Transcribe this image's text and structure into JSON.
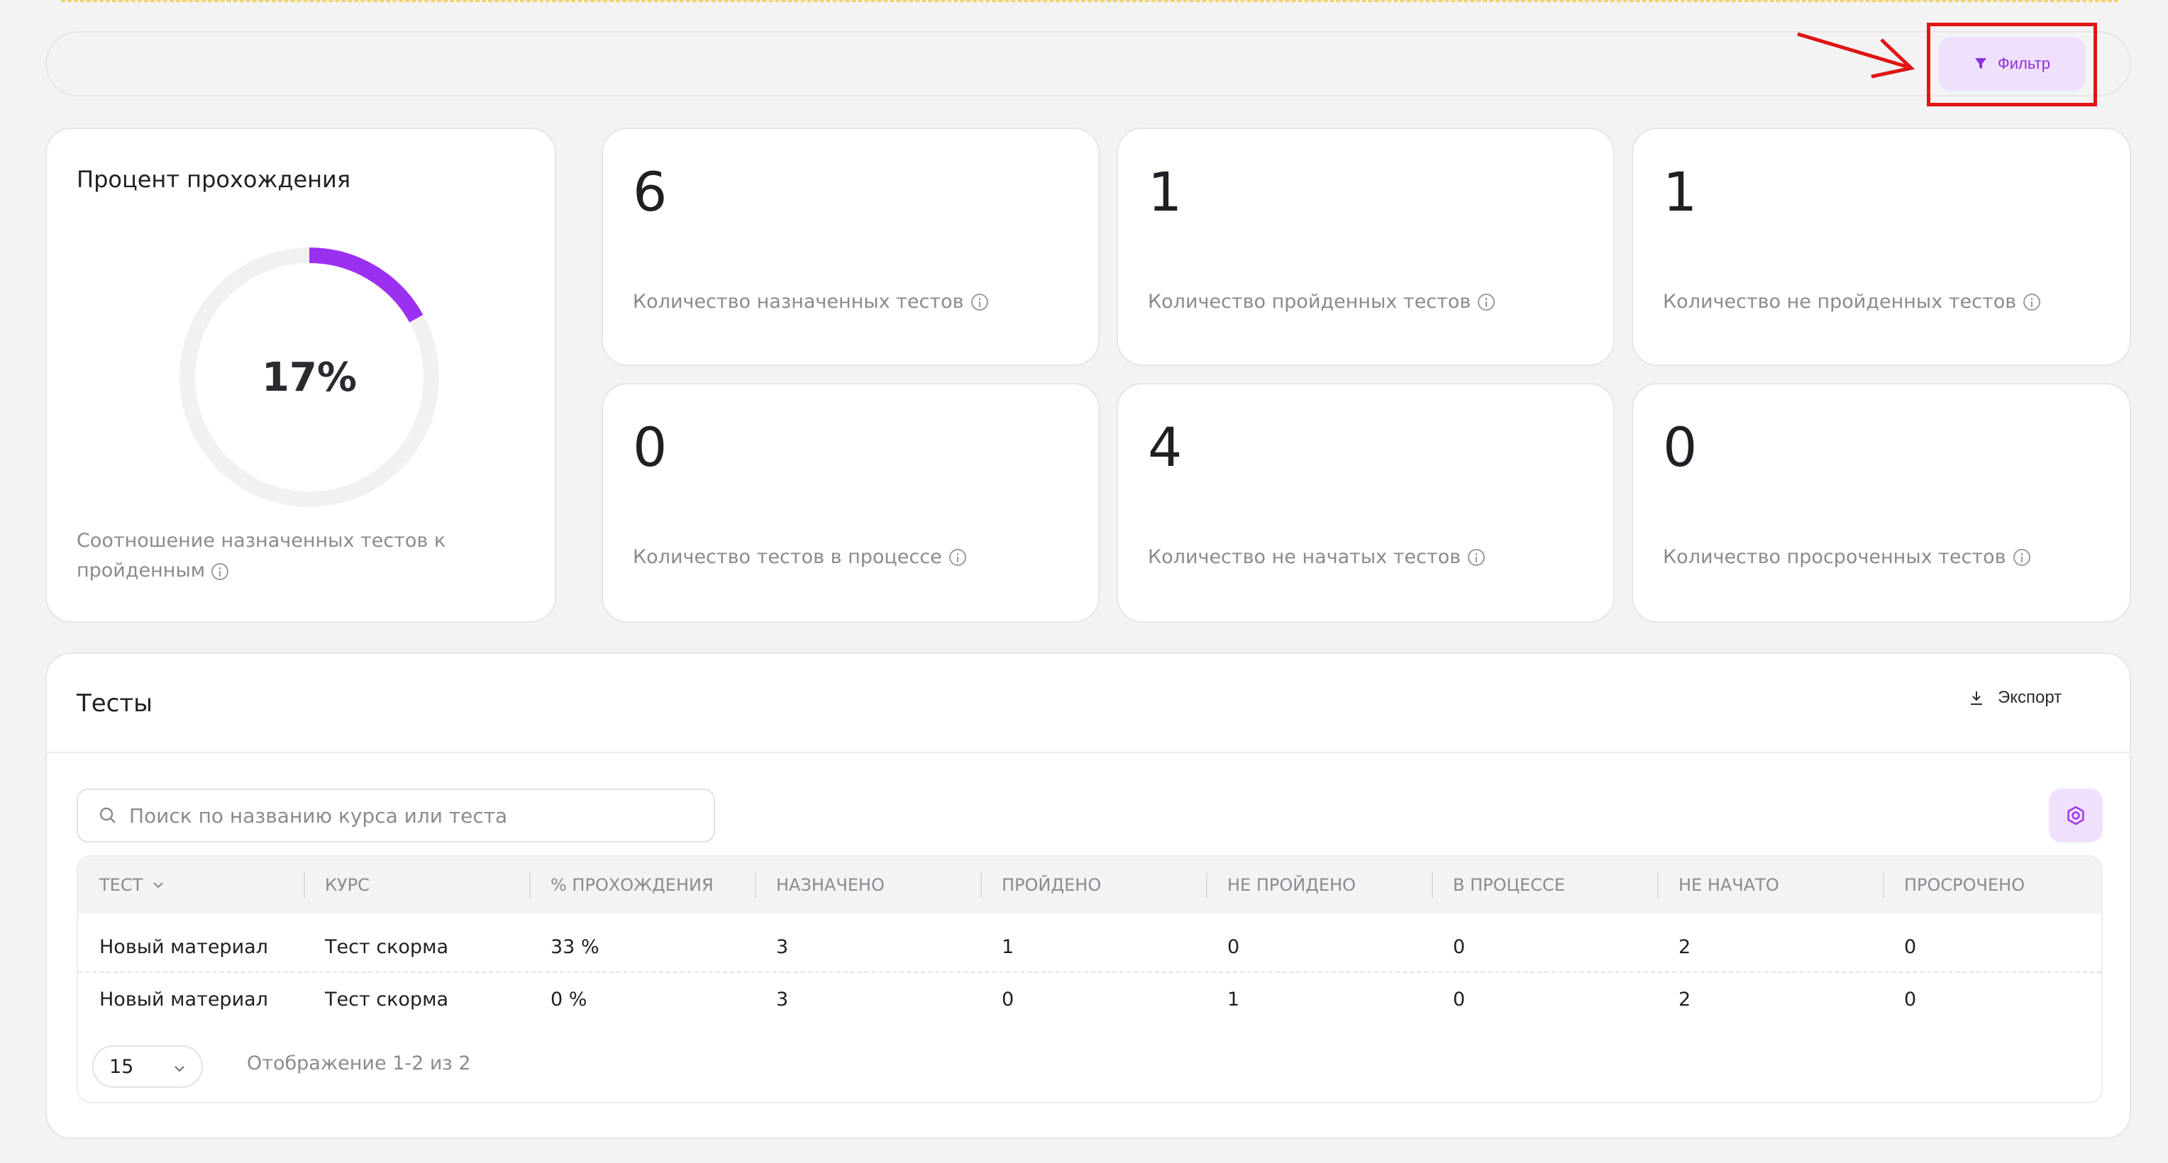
{
  "filter": {
    "label": "Фильтр",
    "icon": "funnel-icon"
  },
  "percent_card": {
    "title": "Процент прохождения",
    "value_text": "17%",
    "value": 17,
    "description": "Соотношение назначенных тестов к пройденным",
    "ring_color": "#9b30f0"
  },
  "stats": [
    {
      "value": "6",
      "label": "Количество назначенных тестов"
    },
    {
      "value": "1",
      "label": "Количество пройденных тестов"
    },
    {
      "value": "1",
      "label": "Количество не пройденных тестов"
    },
    {
      "value": "0",
      "label": "Количество тестов в процессе"
    },
    {
      "value": "4",
      "label": "Количество не начатых тестов"
    },
    {
      "value": "0",
      "label": "Количество просроченных тестов"
    }
  ],
  "tests": {
    "title": "Тесты",
    "export_label": "Экспорт",
    "search_placeholder": "Поиск по названию курса или теста",
    "columns": [
      "ТЕСТ",
      "КУРС",
      "% ПРОХОЖДЕНИЯ",
      "НАЗНАЧЕНО",
      "ПРОЙДЕНО",
      "НЕ ПРОЙДЕНО",
      "В ПРОЦЕССЕ",
      "НЕ НАЧАТО",
      "ПРОСРОЧЕНО"
    ],
    "rows": [
      [
        "Новый материал",
        "Тест скорма",
        "33 %",
        "3",
        "1",
        "0",
        "0",
        "2",
        "0"
      ],
      [
        "Новый материал",
        "Тест скорма",
        "0 %",
        "3",
        "0",
        "1",
        "0",
        "2",
        "0"
      ]
    ],
    "page_size": "15",
    "pagination_info": "Отображение 1-2 из 2"
  },
  "colors": {
    "accent": "#9b30f0",
    "accent_bg": "#efe1fb",
    "annotation": "#e01414"
  }
}
